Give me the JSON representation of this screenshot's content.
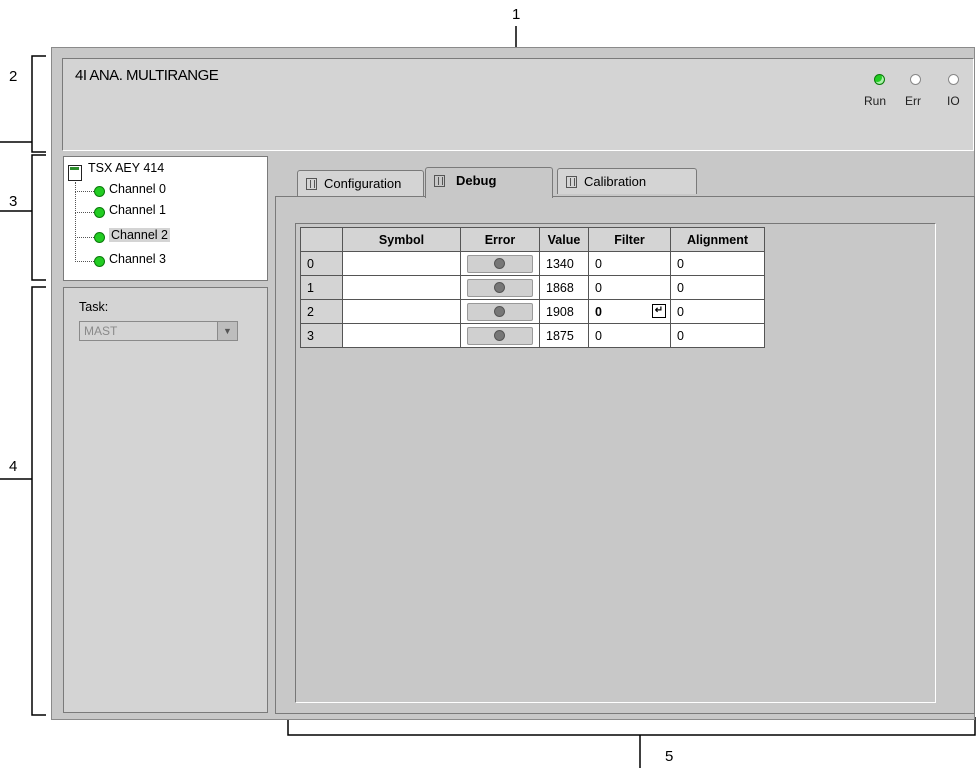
{
  "callouts": {
    "c1": "1",
    "c2": "2",
    "c3": "3",
    "c4": "4",
    "c5": "5"
  },
  "header": {
    "title": "4I ANA. MULTIRANGE",
    "leds": [
      {
        "label": "Run",
        "color": "#22cc22"
      },
      {
        "label": "Err",
        "color": "#ffffff"
      },
      {
        "label": "IO",
        "color": "#ffffff"
      }
    ]
  },
  "tree": {
    "root": "TSX AEY 414",
    "channels": [
      "Channel 0",
      "Channel 1",
      "Channel 2",
      "Channel 3"
    ],
    "selected": "Channel 2"
  },
  "task": {
    "label": "Task:",
    "value": "MAST"
  },
  "tabs": [
    {
      "label": "Configuration",
      "active": false
    },
    {
      "label": "Debug",
      "active": true
    },
    {
      "label": "Calibration",
      "active": false
    }
  ],
  "table": {
    "columns": [
      "Symbol",
      "Error",
      "Value",
      "Filter",
      "Alignment"
    ],
    "rows": [
      {
        "num": "0",
        "symbol": "",
        "value": "1340",
        "filter": "0",
        "alignment": "0"
      },
      {
        "num": "1",
        "symbol": "",
        "value": "1868",
        "filter": "0",
        "alignment": "0"
      },
      {
        "num": "2",
        "symbol": "",
        "value": "1908",
        "filter": "0",
        "alignment": "0"
      },
      {
        "num": "3",
        "symbol": "",
        "value": "1875",
        "filter": "0",
        "alignment": "0"
      }
    ]
  },
  "colors": {
    "led_on": "#22cc22",
    "window_bg": "#c8c8c8",
    "panel_bg": "#d4d4d4"
  }
}
